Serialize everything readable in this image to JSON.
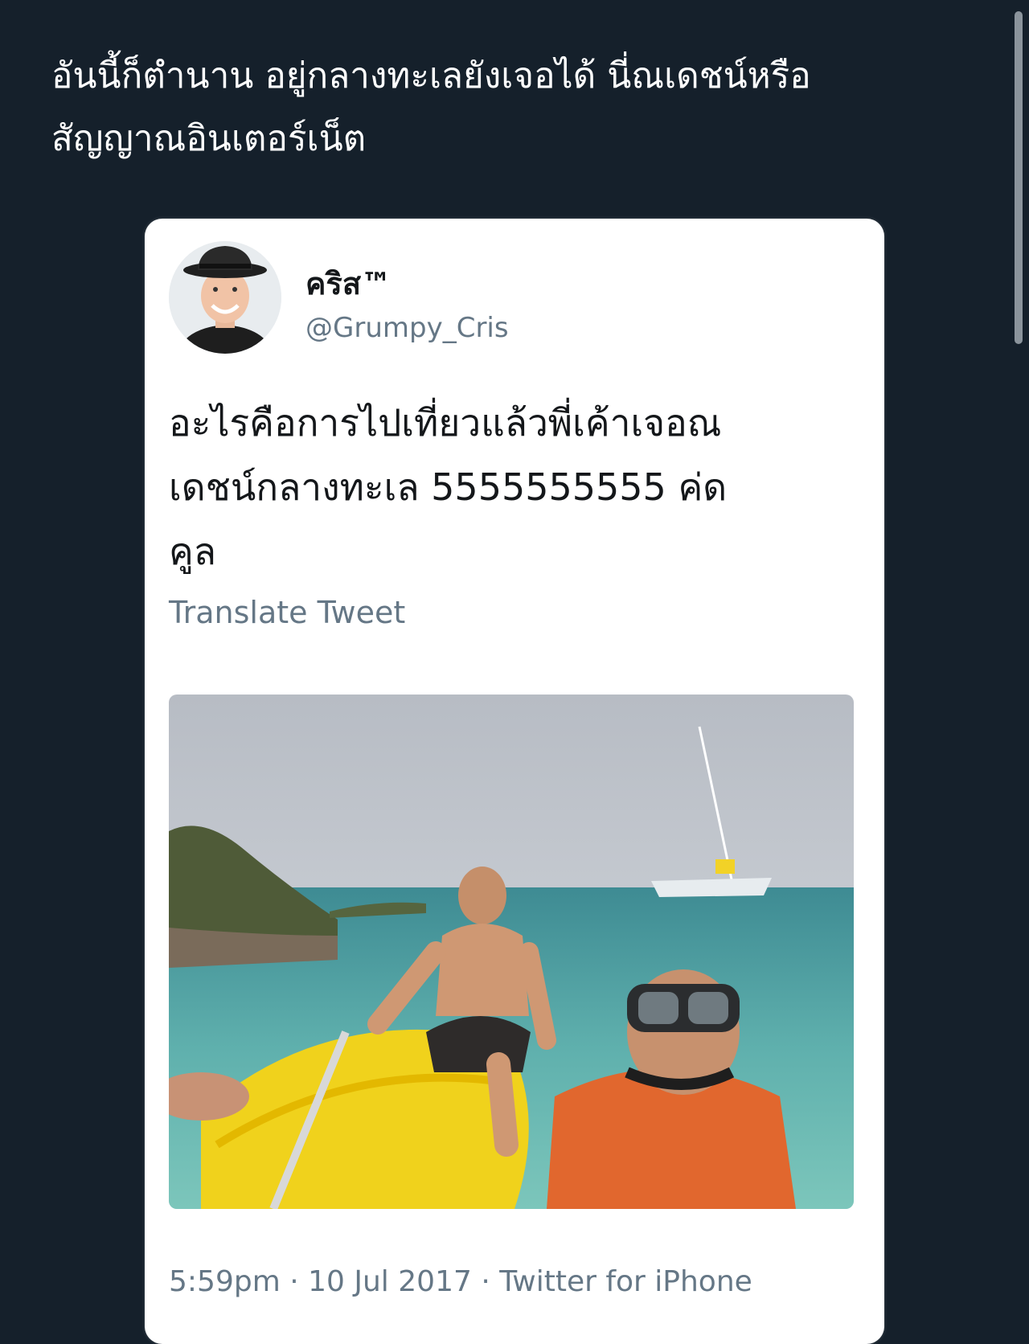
{
  "caption": {
    "line1": "อันนี้ก็ตำนาน อยู่กลางทะเลยังเจอได้ นี่ณเดชน์หรือ",
    "line2": "สัญญาณอินเตอร์เน็ต"
  },
  "tweet": {
    "display_name": "คริส™",
    "handle": "@Grumpy_Cris",
    "text_line1": "อะไรคือการไปเที่ยวแล้วพี่เค้าเจอณ",
    "text_line2": "เดชน์กลางทะเล 5555555555 ค่ด",
    "text_line3": "คูล",
    "translate_label": "Translate Tweet",
    "time": "5:59pm",
    "separator": "·",
    "date": "10 Jul 2017",
    "source": "Twitter for iPhone"
  },
  "colors": {
    "background": "#15202b",
    "card": "#ffffff",
    "secondary_text": "#657786"
  }
}
